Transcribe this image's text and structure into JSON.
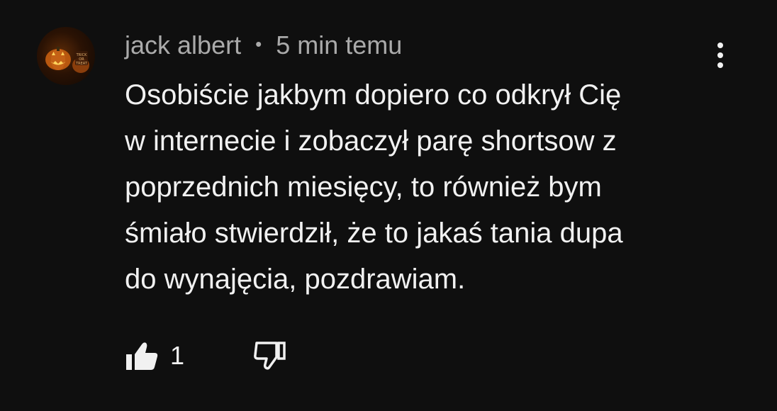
{
  "comment": {
    "author": "jack albert",
    "separator": "•",
    "timestamp": "5 min temu",
    "text_lines": [
      "Osobiście jakbym dopiero co odkrył Cię",
      "w internecie i zobaczył parę shortsow z",
      "poprzednich miesięcy, to również bym",
      "śmiało stwierdził, że to jakaś tania dupa",
      "do wynajęcia, pozdrawiam."
    ],
    "like_count": "1",
    "avatar_caption": "TRICK OR TREAT"
  },
  "icons": {
    "avatar": "pumpkin-avatar-icon",
    "menu": "more-vert-icon",
    "like": "thumbs-up-filled-icon",
    "dislike": "thumbs-down-outline-icon"
  },
  "colors": {
    "background": "#0f0f0f",
    "text_primary": "#f1f1f1",
    "text_secondary": "#aaaaaa"
  }
}
